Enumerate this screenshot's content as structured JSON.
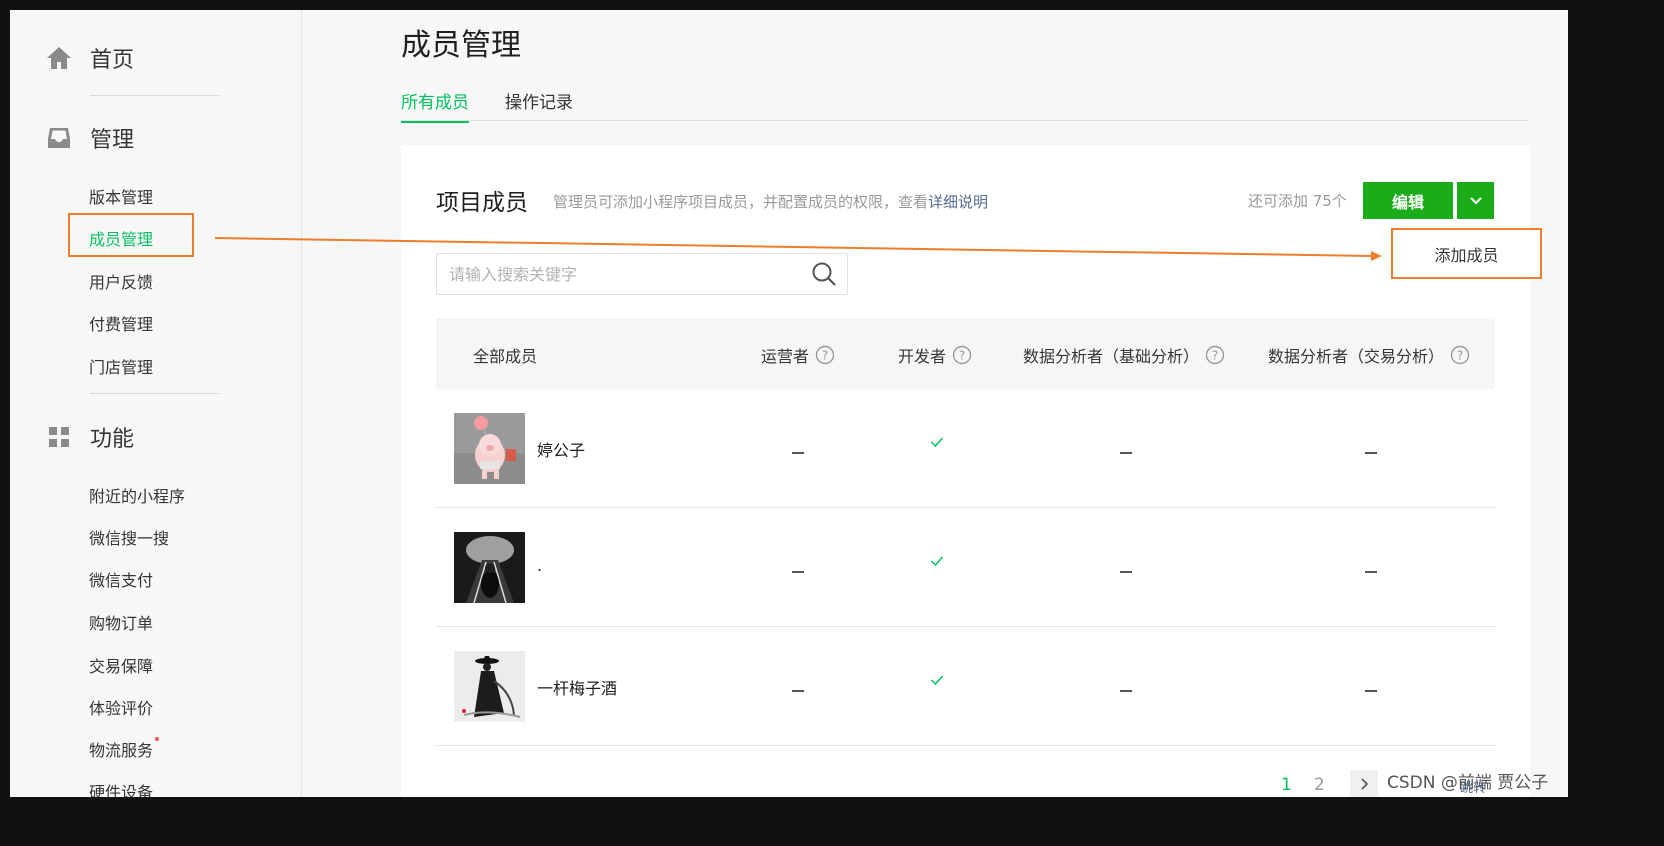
{
  "sidebar": {
    "home": {
      "label": "首页",
      "icon": "home-icon"
    },
    "manage": {
      "label": "管理",
      "icon": "inbox-icon",
      "items": [
        {
          "label": "版本管理"
        },
        {
          "label": "成员管理",
          "active": true
        },
        {
          "label": "用户反馈"
        },
        {
          "label": "付费管理"
        },
        {
          "label": "门店管理"
        }
      ]
    },
    "features": {
      "label": "功能",
      "icon": "grid-icon",
      "items": [
        {
          "label": "附近的小程序"
        },
        {
          "label": "微信搜一搜"
        },
        {
          "label": "微信支付"
        },
        {
          "label": "购物订单"
        },
        {
          "label": "交易保障"
        },
        {
          "label": "体验评价"
        },
        {
          "label": "物流服务",
          "badge": "red-dot"
        },
        {
          "label": "硬件设备"
        }
      ]
    }
  },
  "page": {
    "title": "成员管理",
    "tabs": [
      {
        "label": "所有成员",
        "active": true
      },
      {
        "label": "操作记录"
      }
    ]
  },
  "card": {
    "title": "项目成员",
    "desc_prefix": "管理员可添加小程序项目成员，并配置成员的权限，查看",
    "desc_link": "详细说明",
    "remain": "还可添加 75个",
    "edit_label": "编辑",
    "dropdown_item": "添加成员",
    "search_placeholder": "请输入搜索关键字"
  },
  "table": {
    "columns": [
      "全部成员",
      "运营者",
      "开发者",
      "数据分析者（基础分析）",
      "数据分析者（交易分析）"
    ],
    "rows": [
      {
        "name": "婷公子",
        "operator": "-",
        "developer": "✓",
        "analyst_basic": "-",
        "analyst_trade": "-"
      },
      {
        "name": ".",
        "operator": "-",
        "developer": "✓",
        "analyst_basic": "-",
        "analyst_trade": "-"
      },
      {
        "name": "一杆梅子酒",
        "operator": "-",
        "developer": "✓",
        "analyst_basic": "-",
        "analyst_trade": "-"
      }
    ]
  },
  "pagination": {
    "pages": [
      "1",
      "2"
    ],
    "current": "1"
  },
  "watermark": {
    "text": "CSDN @前端 贾公子",
    "small": "跳转"
  },
  "colors": {
    "brand_green": "#07c160",
    "button_green": "#1aad19",
    "annotation_orange": "#ef7d2b",
    "link_blue": "#576b95"
  }
}
